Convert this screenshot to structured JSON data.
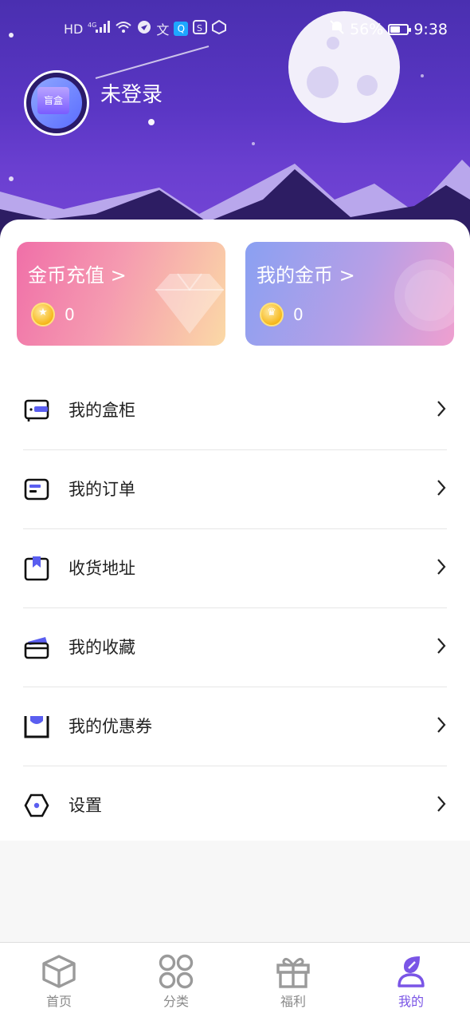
{
  "status_bar": {
    "left_icons": [
      "HD",
      "4G",
      "signal",
      "wifi",
      "app",
      "translate",
      "search-app",
      "sync-app",
      "hand-app"
    ],
    "battery_percent": "56%",
    "battery_level": 0.56,
    "time": "9:38"
  },
  "profile": {
    "username": "未登录",
    "avatar_text": "盲盒"
  },
  "coin_cards": {
    "recharge": {
      "title": "金币充值 >",
      "amount": "0"
    },
    "mine": {
      "title": "我的金币 >",
      "amount": "0"
    }
  },
  "menu": [
    {
      "label": "我的盒柜",
      "icon": "box-cabinet-icon"
    },
    {
      "label": "我的订单",
      "icon": "order-icon"
    },
    {
      "label": "收货地址",
      "icon": "address-icon"
    },
    {
      "label": "我的收藏",
      "icon": "favorites-icon"
    },
    {
      "label": "我的优惠券",
      "icon": "coupon-icon"
    },
    {
      "label": "设置",
      "icon": "settings-icon"
    }
  ],
  "tabs": [
    {
      "label": "首页",
      "icon": "home-box-icon",
      "active": false
    },
    {
      "label": "分类",
      "icon": "category-icon",
      "active": false
    },
    {
      "label": "福利",
      "icon": "gift-icon",
      "active": false
    },
    {
      "label": "我的",
      "icon": "profile-icon",
      "active": true
    }
  ],
  "colors": {
    "header_purple": "#5a36c4",
    "accent": "#7a55e6",
    "icon_blue": "#5a5ef0"
  }
}
